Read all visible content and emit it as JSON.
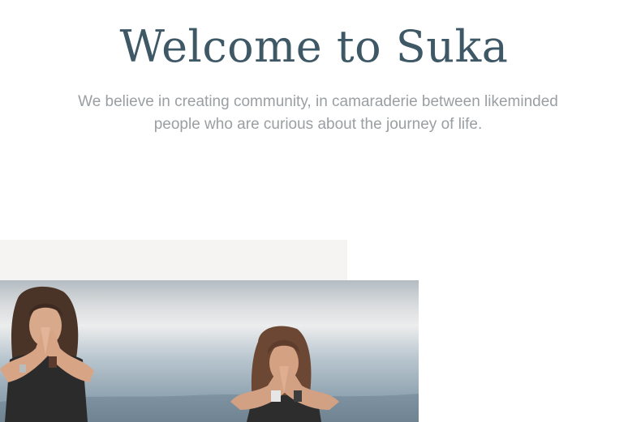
{
  "hero": {
    "title": "Welcome to Suka",
    "subtitle": "We believe in creating community, in camaraderie between likeminded people who are curious about the journey of life."
  },
  "photo": {
    "icon": "yoga-namaste-photo"
  },
  "colors": {
    "title": "#3f5866",
    "subtitle": "#9a9fa2",
    "panel": "#f5f4f2"
  }
}
